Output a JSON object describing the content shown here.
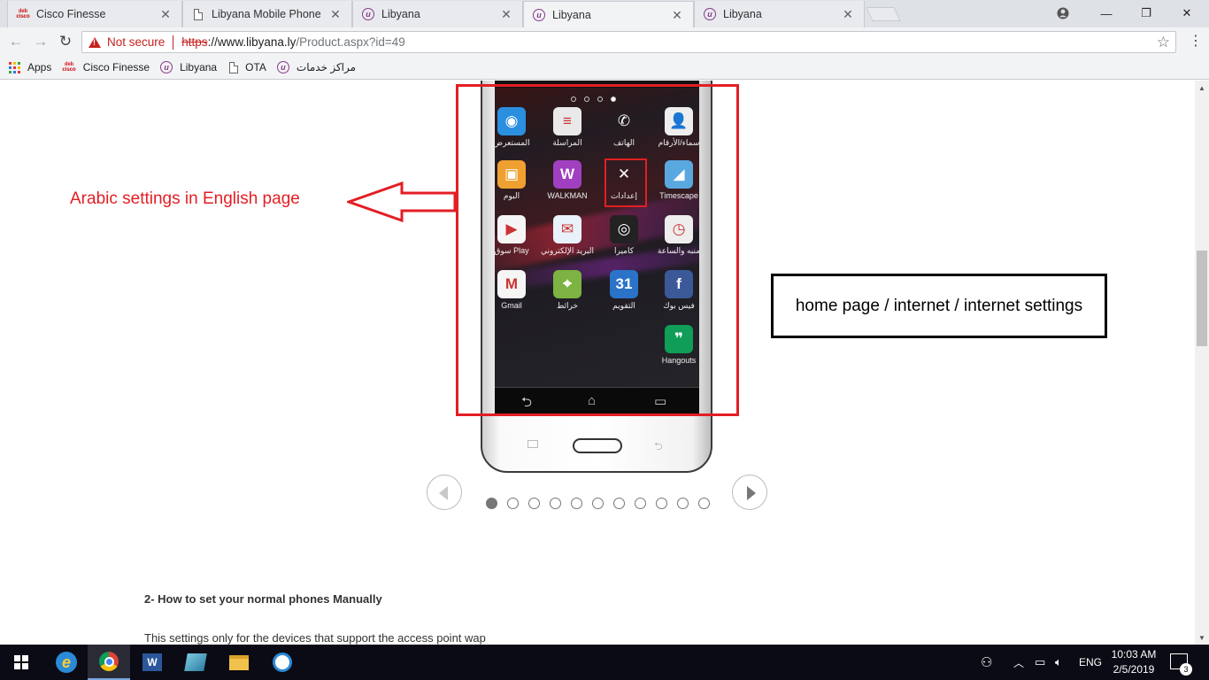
{
  "browser": {
    "tabs": [
      {
        "title": "Cisco Finesse",
        "icon": "cisco-icon",
        "active": false
      },
      {
        "title": "Libyana Mobile Phone",
        "icon": "page-icon",
        "active": false
      },
      {
        "title": "Libyana",
        "icon": "libyana-icon",
        "active": false
      },
      {
        "title": "Libyana",
        "icon": "libyana-icon",
        "active": true
      },
      {
        "title": "Libyana",
        "icon": "libyana-icon",
        "active": false
      }
    ],
    "security_label": "Not secure",
    "url": {
      "scheme": "https",
      "host": "://www.libyana.ly",
      "path": "/Product.aspx?id=49"
    },
    "bookmarks": [
      {
        "label": "Apps",
        "icon": "apps-grid-icon"
      },
      {
        "label": "Cisco Finesse",
        "icon": "cisco-icon"
      },
      {
        "label": "Libyana",
        "icon": "libyana-icon"
      },
      {
        "label": "OTA",
        "icon": "page-icon"
      },
      {
        "label": "مراكز خدمات",
        "icon": "libyana-icon"
      }
    ]
  },
  "phone": {
    "apps": [
      {
        "label": "المستعرض",
        "color": "#2b8fe0",
        "glyph": "◉"
      },
      {
        "label": "المراسلة",
        "color": "#e9e9e9",
        "glyph": "≡"
      },
      {
        "label": "الهاتف",
        "color": "transparent",
        "glyph": "✆"
      },
      {
        "label": "سماء/الأرقام",
        "color": "#eeeeee",
        "glyph": "👤"
      },
      {
        "label": "البوم",
        "color": "#f0a030",
        "glyph": "▣"
      },
      {
        "label": "WALKMAN",
        "color": "#a040c0",
        "glyph": "W"
      },
      {
        "label": "إعدادات",
        "color": "transparent",
        "glyph": "✕"
      },
      {
        "label": "Timescape",
        "color": "#5aa8e0",
        "glyph": "◢"
      },
      {
        "label": "سوق Play",
        "color": "#f5f5f5",
        "glyph": "▶"
      },
      {
        "label": "البريد الإلكتروني",
        "color": "#e9f1fa",
        "glyph": "✉"
      },
      {
        "label": "كاميرا",
        "color": "#222222",
        "glyph": "◎"
      },
      {
        "label": "منبه والساعة",
        "color": "#eeeeee",
        "glyph": "◷"
      },
      {
        "label": "Gmail",
        "color": "#f5f5f5",
        "glyph": "M"
      },
      {
        "label": "خرائط",
        "color": "#7cb342",
        "glyph": "⌖"
      },
      {
        "label": "التقويم",
        "color": "#2a73c9",
        "glyph": "31"
      },
      {
        "label": "فيس بوك",
        "color": "#3b5998",
        "glyph": "f"
      },
      {
        "label": "Hangouts",
        "color": "#0f9d58",
        "glyph": "❞"
      }
    ]
  },
  "annotations": {
    "arabic_note": "Arabic settings in English page",
    "path_note": "home page / internet / internet settings"
  },
  "carousel": {
    "slide_count": 11,
    "active_index": 0
  },
  "article": {
    "heading": "2- How to set your normal phones Manually",
    "text": "This settings only for the devices that support the access point wap"
  },
  "taskbar": {
    "pinned": [
      "ie-icon",
      "chrome-icon",
      "word-icon",
      "app-icon",
      "file-explorer-icon",
      "app2-icon"
    ],
    "language": "ENG",
    "time": "10:03 AM",
    "date": "2/5/2019",
    "notification_count": "3"
  }
}
